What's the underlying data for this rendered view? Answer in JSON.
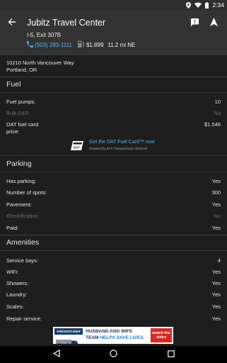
{
  "status_bar": {
    "time": "2:34"
  },
  "header": {
    "title": "Jubitz Travel Center",
    "exit": "I-5, Exit 307B",
    "phone": "(503) 283-1111",
    "price": "$1.899",
    "distance": "11.2 mi NE"
  },
  "address": {
    "line1": "10210 North Vancouver Way",
    "line2": "Portland, OR"
  },
  "fuel": {
    "title": "Fuel",
    "pumps_label": "Fuel pumps:",
    "pumps_value": "10",
    "bulk_def_label": "Bulk DEF:",
    "bulk_def_value": "No",
    "dat_price_label_1": "DAT fuel card",
    "dat_price_label_2": "price:",
    "dat_price_value": "$1.546",
    "promo_link": "Get the DAT Fuel Card™ now",
    "promo_sub": "Powered by EFS Transportation Services"
  },
  "parking": {
    "title": "Parking",
    "has_parking_label": "Has parking:",
    "has_parking_value": "Yes",
    "spots_label": "Number of spots:",
    "spots_value": "300",
    "pavement_label": "Pavement:",
    "pavement_value": "Yes",
    "electrification_label": "Electrification:",
    "electrification_value": "No",
    "paid_label": "Paid:",
    "paid_value": "Yes"
  },
  "amenities": {
    "title": "Amenities",
    "service_bays_label": "Service bays:",
    "service_bays_value": "4",
    "wifi_label": "WiFi:",
    "wifi_value": "Yes",
    "showers_label": "Showers:",
    "showers_value": "Yes",
    "laundry_label": "Laundry:",
    "laundry_value": "Yes",
    "scales_label": "Scales:",
    "scales_value": "Yes",
    "repair_label": "Repair service:",
    "repair_value": "Yes"
  },
  "ad": {
    "brand": "FREIGHTLINER",
    "line1": "HUSBAND AND WIFE",
    "line2a": "TEAM ",
    "line2b": "HELPS SAVE LIVES.",
    "cta": "watch the video"
  },
  "colors": {
    "link": "#5bb3e8",
    "header_bg": "#333333",
    "page_bg": "#1e1e1e",
    "muted": "#6c6c6c"
  },
  "icons": [
    "back-arrow-icon",
    "chat-icon",
    "navigate-icon",
    "phone-icon",
    "fuel-pump-icon",
    "location-icon",
    "wifi-icon",
    "battery-icon"
  ]
}
